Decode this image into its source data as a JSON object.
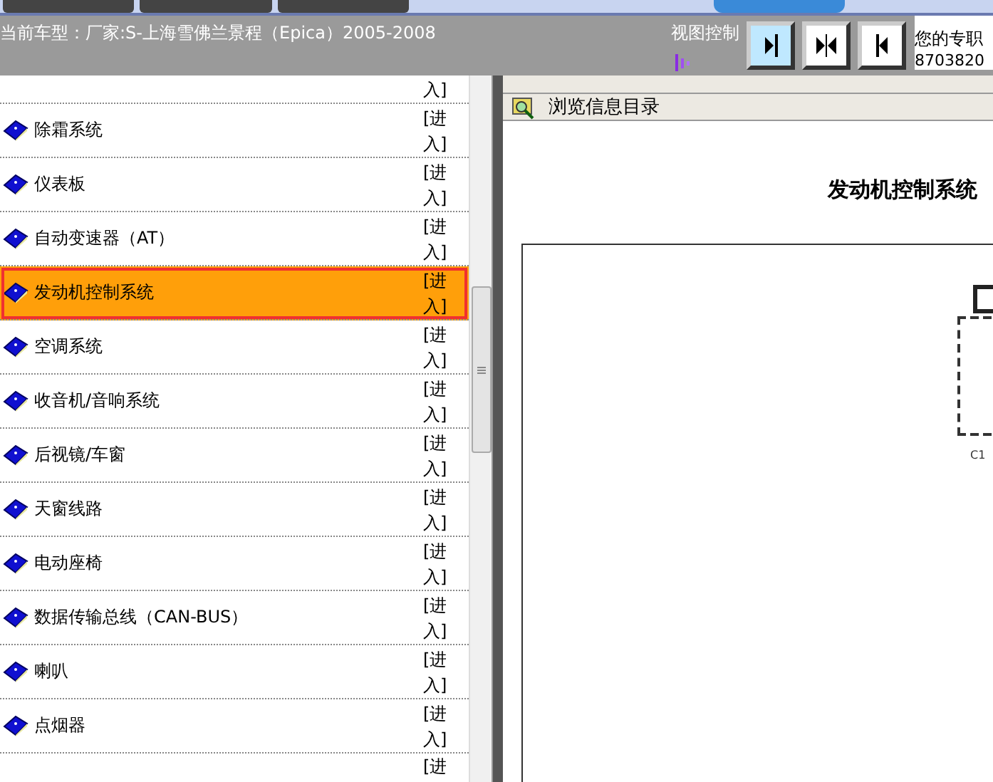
{
  "top_tabs": [
    {
      "selected": false
    },
    {
      "selected": false
    },
    {
      "selected": false
    },
    {
      "selected": true
    }
  ],
  "header": {
    "car_model": "当前车型：厂家:S-上海雪佛兰景程（Epica）2005-2008",
    "view_control_label": "视图控制",
    "view_buttons": [
      {
        "kind": "right"
      },
      {
        "kind": "both"
      },
      {
        "kind": "left"
      }
    ],
    "contact_label": "您的专职",
    "contact_number": "8703820"
  },
  "sidebar": {
    "top_partial_link": "入]",
    "items": [
      {
        "label": "除霜系统",
        "link": "[进入]",
        "selected": false
      },
      {
        "label": "仪表板",
        "link": "[进入]",
        "selected": false
      },
      {
        "label": "自动变速器（AT）",
        "link": "[进入]",
        "selected": false
      },
      {
        "label": "发动机控制系统",
        "link": "[进入]",
        "selected": true
      },
      {
        "label": "空调系统",
        "link": "[进入]",
        "selected": false
      },
      {
        "label": "收音机/音响系统",
        "link": "[进入]",
        "selected": false
      },
      {
        "label": "后视镜/车窗",
        "link": "[进入]",
        "selected": false
      },
      {
        "label": "天窗线路",
        "link": "[进入]",
        "selected": false
      },
      {
        "label": "电动座椅",
        "link": "[进入]",
        "selected": false
      },
      {
        "label": "数据传输总线（CAN-BUS）",
        "link": "[进入]",
        "selected": false
      },
      {
        "label": "喇叭",
        "link": "[进入]",
        "selected": false
      },
      {
        "label": "点烟器",
        "link": "[进入]",
        "selected": false
      }
    ],
    "bottom_partial_link": "[进"
  },
  "content": {
    "toolbar_label": "浏览信息目录",
    "title": "发动机控制系统",
    "diagram_label": "C1"
  }
}
